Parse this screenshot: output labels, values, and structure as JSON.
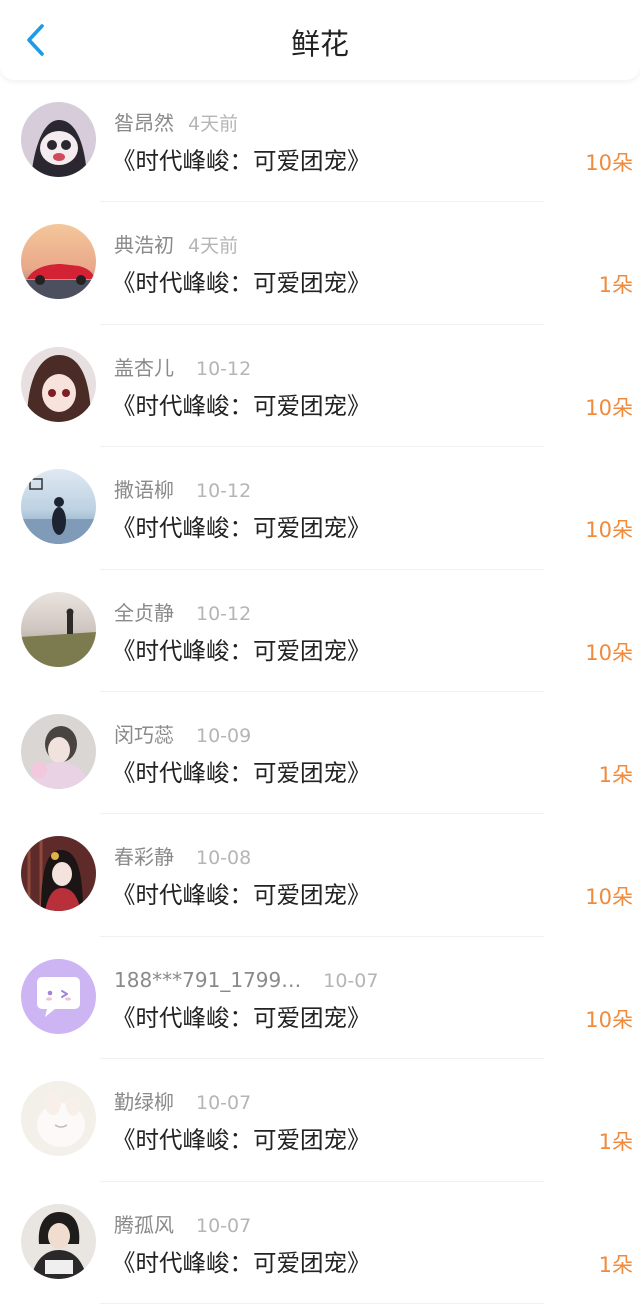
{
  "header": {
    "title": "鲜花",
    "back_icon": "chevron-left-icon",
    "accent": "#1E9BE8"
  },
  "colors": {
    "count": "#F08A3C",
    "name": "#8A8A8A",
    "time": "#B5B5B5",
    "book": "#222222"
  },
  "items": [
    {
      "name": "昝昂然",
      "time": "4天前",
      "book": "《时代峰峻：可爱团宠》",
      "count": "10朵"
    },
    {
      "name": "典浩初",
      "time": "4天前",
      "book": "《时代峰峻：可爱团宠》",
      "count": "1朵"
    },
    {
      "name": "盖杏儿",
      "time": "10-12",
      "book": "《时代峰峻：可爱团宠》",
      "count": "10朵"
    },
    {
      "name": "撒语柳",
      "time": "10-12",
      "book": "《时代峰峻：可爱团宠》",
      "count": "10朵"
    },
    {
      "name": "全贞静",
      "time": "10-12",
      "book": "《时代峰峻：可爱团宠》",
      "count": "10朵"
    },
    {
      "name": "闵巧蕊",
      "time": "10-09",
      "book": "《时代峰峻：可爱团宠》",
      "count": "1朵"
    },
    {
      "name": "春彩静",
      "time": "10-08",
      "book": "《时代峰峻：可爱团宠》",
      "count": "10朵"
    },
    {
      "name": "188***791_1799…",
      "time": "10-07",
      "book": "《时代峰峻：可爱团宠》",
      "count": "10朵"
    },
    {
      "name": "勤绿柳",
      "time": "10-07",
      "book": "《时代峰峻：可爱团宠》",
      "count": "1朵"
    },
    {
      "name": "腾孤风",
      "time": "10-07",
      "book": "《时代峰峻：可爱团宠》",
      "count": "1朵"
    }
  ]
}
